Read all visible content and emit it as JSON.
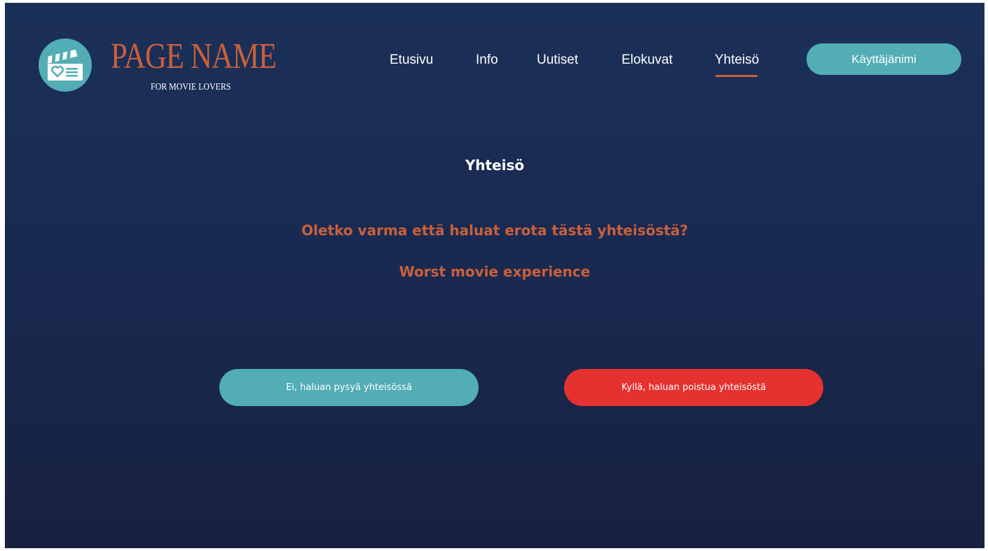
{
  "brand": {
    "title": "PAGE NAME",
    "subtitle": "FOR MOVIE LOVERS",
    "logo_icon": "clapperboard-heart-icon"
  },
  "nav": {
    "items": [
      {
        "label": "Etusivu"
      },
      {
        "label": "Info"
      },
      {
        "label": "Uutiset"
      },
      {
        "label": "Elokuvat"
      },
      {
        "label": "Yhteisö",
        "active": true
      }
    ],
    "user_button": "Käyttäjänimi"
  },
  "main": {
    "title": "Yhteisö",
    "question": "Oletko varma että haluat erota tästä yhteisöstä?",
    "community_name": "Worst movie experience"
  },
  "actions": {
    "stay_label": "Ei, haluan pysyä yhteisössä",
    "leave_label": "Kyllä, haluan poistua yhteisöstä"
  },
  "colors": {
    "background": "#1a2d55",
    "accent_orange": "#c9603b",
    "teal": "#52adb5",
    "danger_red": "#e5322f",
    "text": "#ffffff"
  }
}
